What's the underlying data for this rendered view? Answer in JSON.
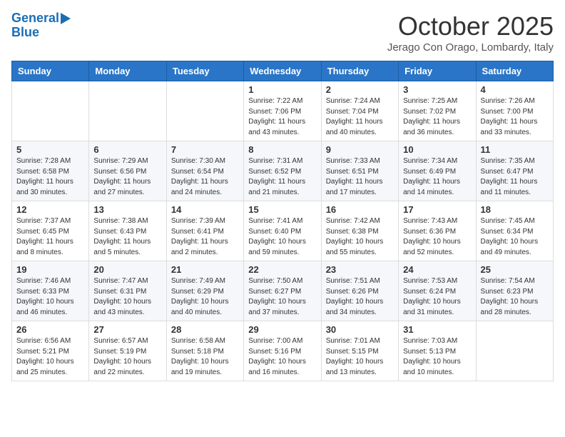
{
  "header": {
    "logo_line1": "General",
    "logo_line2": "Blue",
    "month_title": "October 2025",
    "location": "Jerago Con Orago, Lombardy, Italy"
  },
  "days_of_week": [
    "Sunday",
    "Monday",
    "Tuesday",
    "Wednesday",
    "Thursday",
    "Friday",
    "Saturday"
  ],
  "weeks": [
    [
      {
        "day": "",
        "info": ""
      },
      {
        "day": "",
        "info": ""
      },
      {
        "day": "",
        "info": ""
      },
      {
        "day": "1",
        "info": "Sunrise: 7:22 AM\nSunset: 7:06 PM\nDaylight: 11 hours and 43 minutes."
      },
      {
        "day": "2",
        "info": "Sunrise: 7:24 AM\nSunset: 7:04 PM\nDaylight: 11 hours and 40 minutes."
      },
      {
        "day": "3",
        "info": "Sunrise: 7:25 AM\nSunset: 7:02 PM\nDaylight: 11 hours and 36 minutes."
      },
      {
        "day": "4",
        "info": "Sunrise: 7:26 AM\nSunset: 7:00 PM\nDaylight: 11 hours and 33 minutes."
      }
    ],
    [
      {
        "day": "5",
        "info": "Sunrise: 7:28 AM\nSunset: 6:58 PM\nDaylight: 11 hours and 30 minutes."
      },
      {
        "day": "6",
        "info": "Sunrise: 7:29 AM\nSunset: 6:56 PM\nDaylight: 11 hours and 27 minutes."
      },
      {
        "day": "7",
        "info": "Sunrise: 7:30 AM\nSunset: 6:54 PM\nDaylight: 11 hours and 24 minutes."
      },
      {
        "day": "8",
        "info": "Sunrise: 7:31 AM\nSunset: 6:52 PM\nDaylight: 11 hours and 21 minutes."
      },
      {
        "day": "9",
        "info": "Sunrise: 7:33 AM\nSunset: 6:51 PM\nDaylight: 11 hours and 17 minutes."
      },
      {
        "day": "10",
        "info": "Sunrise: 7:34 AM\nSunset: 6:49 PM\nDaylight: 11 hours and 14 minutes."
      },
      {
        "day": "11",
        "info": "Sunrise: 7:35 AM\nSunset: 6:47 PM\nDaylight: 11 hours and 11 minutes."
      }
    ],
    [
      {
        "day": "12",
        "info": "Sunrise: 7:37 AM\nSunset: 6:45 PM\nDaylight: 11 hours and 8 minutes."
      },
      {
        "day": "13",
        "info": "Sunrise: 7:38 AM\nSunset: 6:43 PM\nDaylight: 11 hours and 5 minutes."
      },
      {
        "day": "14",
        "info": "Sunrise: 7:39 AM\nSunset: 6:41 PM\nDaylight: 11 hours and 2 minutes."
      },
      {
        "day": "15",
        "info": "Sunrise: 7:41 AM\nSunset: 6:40 PM\nDaylight: 10 hours and 59 minutes."
      },
      {
        "day": "16",
        "info": "Sunrise: 7:42 AM\nSunset: 6:38 PM\nDaylight: 10 hours and 55 minutes."
      },
      {
        "day": "17",
        "info": "Sunrise: 7:43 AM\nSunset: 6:36 PM\nDaylight: 10 hours and 52 minutes."
      },
      {
        "day": "18",
        "info": "Sunrise: 7:45 AM\nSunset: 6:34 PM\nDaylight: 10 hours and 49 minutes."
      }
    ],
    [
      {
        "day": "19",
        "info": "Sunrise: 7:46 AM\nSunset: 6:33 PM\nDaylight: 10 hours and 46 minutes."
      },
      {
        "day": "20",
        "info": "Sunrise: 7:47 AM\nSunset: 6:31 PM\nDaylight: 10 hours and 43 minutes."
      },
      {
        "day": "21",
        "info": "Sunrise: 7:49 AM\nSunset: 6:29 PM\nDaylight: 10 hours and 40 minutes."
      },
      {
        "day": "22",
        "info": "Sunrise: 7:50 AM\nSunset: 6:27 PM\nDaylight: 10 hours and 37 minutes."
      },
      {
        "day": "23",
        "info": "Sunrise: 7:51 AM\nSunset: 6:26 PM\nDaylight: 10 hours and 34 minutes."
      },
      {
        "day": "24",
        "info": "Sunrise: 7:53 AM\nSunset: 6:24 PM\nDaylight: 10 hours and 31 minutes."
      },
      {
        "day": "25",
        "info": "Sunrise: 7:54 AM\nSunset: 6:23 PM\nDaylight: 10 hours and 28 minutes."
      }
    ],
    [
      {
        "day": "26",
        "info": "Sunrise: 6:56 AM\nSunset: 5:21 PM\nDaylight: 10 hours and 25 minutes."
      },
      {
        "day": "27",
        "info": "Sunrise: 6:57 AM\nSunset: 5:19 PM\nDaylight: 10 hours and 22 minutes."
      },
      {
        "day": "28",
        "info": "Sunrise: 6:58 AM\nSunset: 5:18 PM\nDaylight: 10 hours and 19 minutes."
      },
      {
        "day": "29",
        "info": "Sunrise: 7:00 AM\nSunset: 5:16 PM\nDaylight: 10 hours and 16 minutes."
      },
      {
        "day": "30",
        "info": "Sunrise: 7:01 AM\nSunset: 5:15 PM\nDaylight: 10 hours and 13 minutes."
      },
      {
        "day": "31",
        "info": "Sunrise: 7:03 AM\nSunset: 5:13 PM\nDaylight: 10 hours and 10 minutes."
      },
      {
        "day": "",
        "info": ""
      }
    ]
  ]
}
